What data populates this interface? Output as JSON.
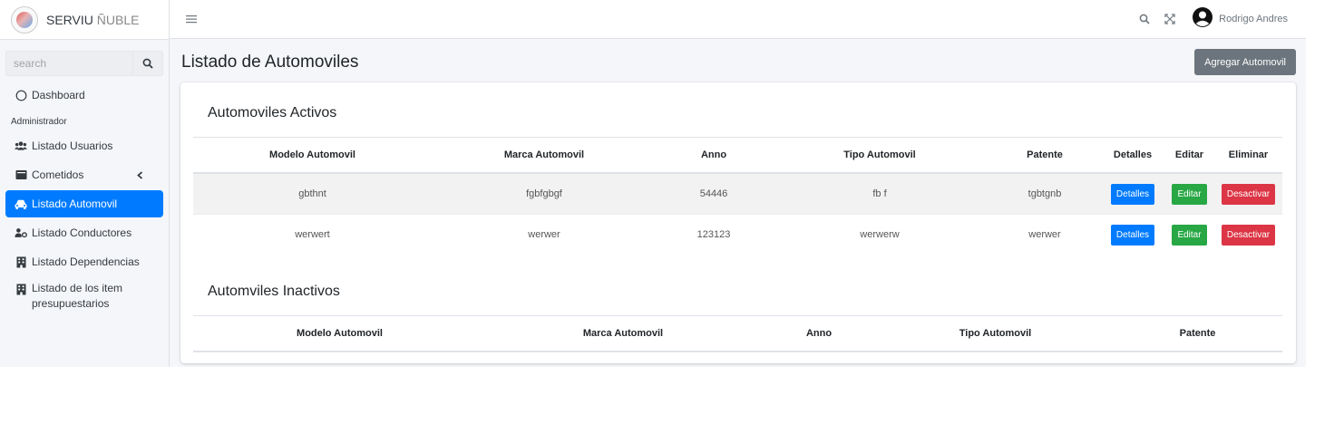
{
  "brand": {
    "name": "SERVIU",
    "subtitle": "ÑUBLE"
  },
  "search": {
    "placeholder": "search"
  },
  "sidebar": {
    "items": [
      {
        "label": "Dashboard"
      },
      {
        "label": "Administrador"
      },
      {
        "label": "Listado Usuarios"
      },
      {
        "label": "Cometidos"
      },
      {
        "label": "Listado Automovil"
      },
      {
        "label": "Listado Conductores"
      },
      {
        "label": "Listado Dependencias"
      },
      {
        "label": "Listado de los item presupuestarios"
      }
    ]
  },
  "topbar": {
    "user_name": "Rodrigo Andres"
  },
  "page": {
    "title": "Listado de Automoviles",
    "add_button": "Agregar Automovil"
  },
  "active_table": {
    "title": "Automoviles Activos",
    "headers": [
      "Modelo Automovil",
      "Marca Automovil",
      "Anno",
      "Tipo Automovil",
      "Patente",
      "Detalles",
      "Editar",
      "Eliminar"
    ],
    "rows": [
      {
        "modelo": "gbthnt",
        "marca": "fgbfgbgf",
        "anno": "54446",
        "tipo": "fb f",
        "patente": "tgbtgnb",
        "detalles": "Detalles",
        "editar": "Editar",
        "eliminar": "Desactivar"
      },
      {
        "modelo": "werwert",
        "marca": "werwer",
        "anno": "123123",
        "tipo": "werwerw",
        "patente": "werwer",
        "detalles": "Detalles",
        "editar": "Editar",
        "eliminar": "Desactivar"
      }
    ]
  },
  "inactive_table": {
    "title": "Automviles Inactivos",
    "headers": [
      "Modelo Automovil",
      "Marca Automovil",
      "Anno",
      "Tipo Automovil",
      "Patente"
    ]
  },
  "colors": {
    "primary": "#007bff",
    "success": "#28a745",
    "danger": "#dc3545",
    "secondary": "#6c757d"
  }
}
